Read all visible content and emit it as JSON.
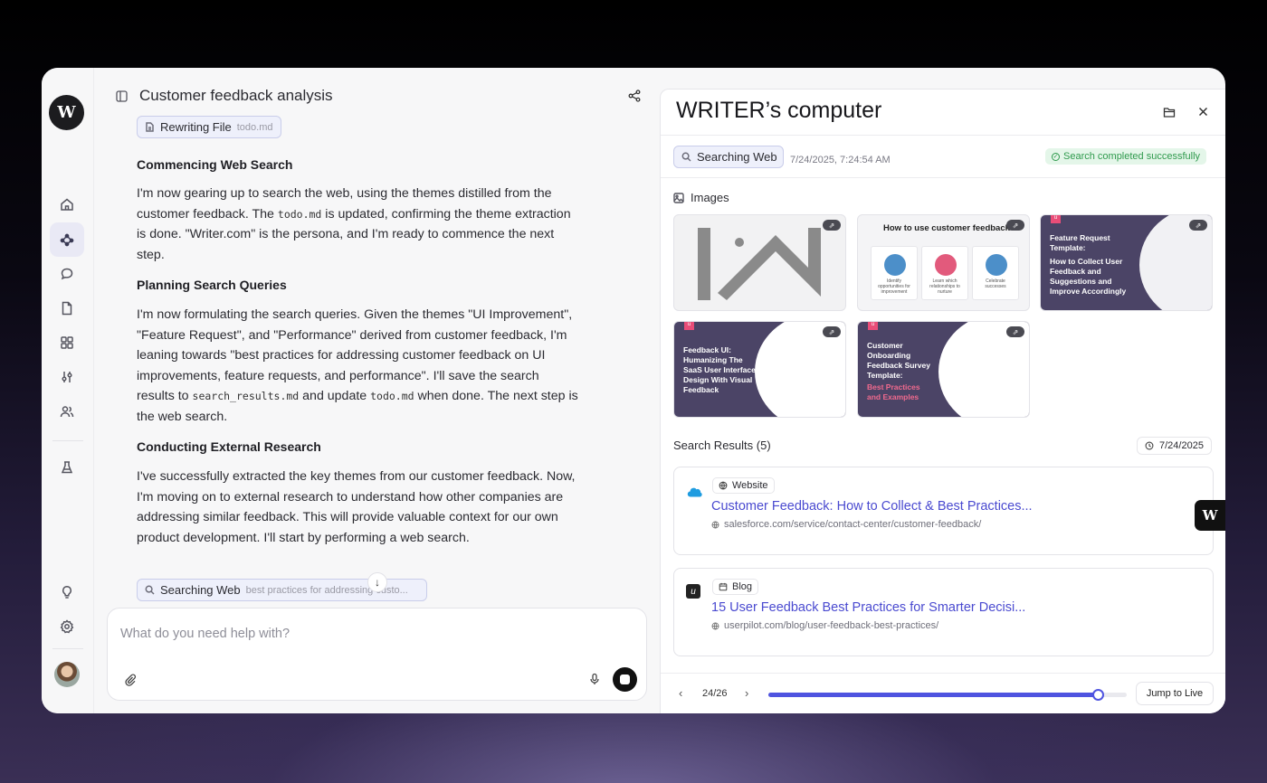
{
  "app": {
    "logo": "W"
  },
  "sidebar": {
    "items": [
      {
        "name": "home",
        "icon": "home-icon"
      },
      {
        "name": "agent",
        "icon": "nodes-icon",
        "active": true
      },
      {
        "name": "chat",
        "icon": "chat-bubble-icon"
      },
      {
        "name": "docs",
        "icon": "document-icon"
      },
      {
        "name": "apps",
        "icon": "grid-icon"
      },
      {
        "name": "tune",
        "icon": "sliders-icon"
      },
      {
        "name": "team",
        "icon": "users-icon"
      },
      {
        "name": "lab",
        "icon": "flask-icon"
      }
    ],
    "bottom": [
      {
        "name": "ideas",
        "icon": "lightbulb-icon"
      },
      {
        "name": "settings",
        "icon": "gear-icon"
      }
    ]
  },
  "chat": {
    "title": "Customer feedback analysis",
    "chip_file": {
      "label": "Rewriting File",
      "sub": "todo.md"
    },
    "sections": [
      {
        "heading": "Commencing Web Search",
        "parts": [
          "I'm now gearing up to search the web, using the themes distilled from the customer feedback. The ",
          "todo.md",
          " is updated, confirming the theme extraction is done. \"Writer.com\" is the persona, and I'm ready to commence the next step."
        ]
      },
      {
        "heading": "Planning Search Queries",
        "parts": [
          "I'm now formulating the search queries. Given the themes \"UI Improvement\", \"Feature Request\", and \"Performance\" derived from customer feedback, I'm leaning towards \"best practices for addressing customer feedback on UI improvements, feature requests, and performance\". I'll save the search results to ",
          "search_results.md",
          " and update ",
          "todo.md",
          " when done. The next step is the web search."
        ]
      },
      {
        "heading": "Conducting External Research",
        "parts": [
          "I've successfully extracted the key themes from our customer feedback. Now, I'm moving on to external research to understand how other companies are addressing similar feedback. This will provide valuable context for our own product development. I'll start by performing a web search."
        ]
      }
    ],
    "chip_search": {
      "label": "Searching Web",
      "sub": "best practices for addressing custo..."
    },
    "composer": {
      "placeholder": "What do you need help with?"
    }
  },
  "computer": {
    "title": "WRITER’s computer",
    "action_chip": "Searching Web",
    "timestamp": "7/24/2025, 7:24:54 AM",
    "status": "Search completed successfully",
    "images_label": "Images",
    "images": [
      {
        "kind": "placeholder"
      },
      {
        "kind": "infographic",
        "title": "How to use customer feedback",
        "cards": [
          "Identify opportunities for improvement",
          "Learn which relationships to nurture",
          "Celebrate successes"
        ]
      },
      {
        "kind": "banner",
        "lines": [
          "Feature Request",
          "Template:",
          "How to Collect User",
          "Feedback and",
          "Suggestions and",
          "Improve Accordingly"
        ]
      },
      {
        "kind": "banner",
        "lines": [
          "Feedback UI:",
          "Humanizing The",
          "SaaS User Interface",
          "Design With Visual",
          "Feedback"
        ]
      },
      {
        "kind": "banner",
        "lines": [
          "Customer",
          "Onboarding",
          "Feedback Survey",
          "Template:"
        ],
        "highlight": [
          "Best Practices",
          "and Examples"
        ]
      }
    ],
    "results_label": "Search Results (5)",
    "results_date": "7/24/2025",
    "results": [
      {
        "type": "Website",
        "title": "Customer Feedback: How to Collect & Best Practices...",
        "url": "salesforce.com/service/contact-center/customer-feedback/",
        "favicon": "salesforce-cloud-icon",
        "color": "#1f9ce0"
      },
      {
        "type": "Blog",
        "title": "15 User Feedback Best Practices for Smarter Decisi...",
        "url": "userpilot.com/blog/user-feedback-best-practices/",
        "favicon": "userpilot-logo-icon",
        "color": "#222222"
      }
    ],
    "footer": {
      "position": "24/26",
      "progress": 0.92,
      "jump_label": "Jump to Live"
    }
  },
  "colors": {
    "accent": "#4f54e0",
    "success": "#2f9a4d",
    "link": "#4a4ad0"
  }
}
